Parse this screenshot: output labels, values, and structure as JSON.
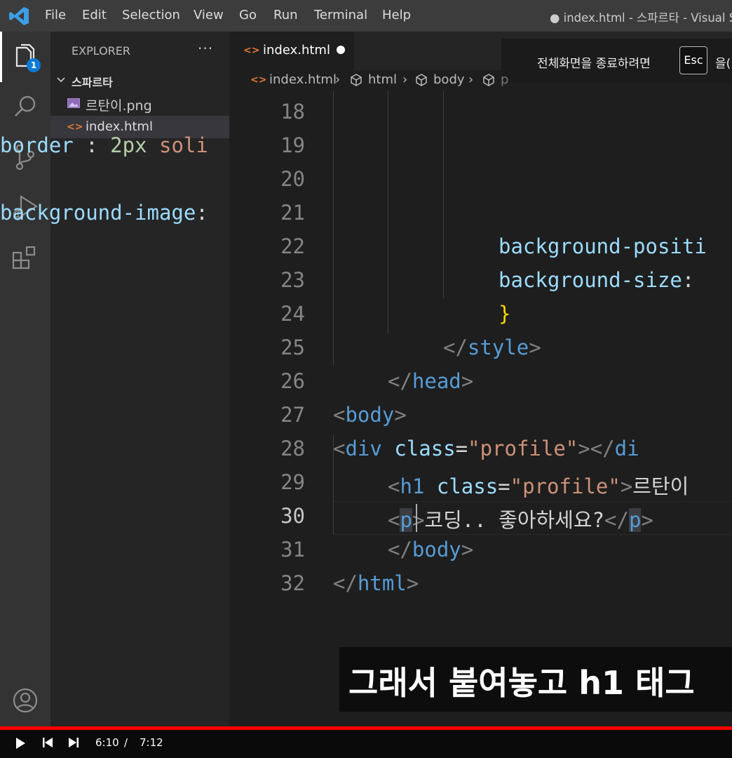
{
  "window": {
    "title": "● index.html - 스파르타 - Visual S"
  },
  "menu": [
    "File",
    "Edit",
    "Selection",
    "View",
    "Go",
    "Run",
    "Terminal",
    "Help"
  ],
  "activity_bar": {
    "items": [
      "explorer-icon",
      "search-icon",
      "source-control-icon",
      "run-debug-icon",
      "extensions-icon",
      "account-icon"
    ],
    "explorer_badge": "1"
  },
  "sidebar": {
    "title": "EXPLORER",
    "more": "···",
    "folder": "스파르타",
    "files": [
      {
        "name": "르탄이.png",
        "icon": "image-file-icon"
      },
      {
        "name": "index.html",
        "icon": "html-file-icon"
      }
    ]
  },
  "tabs": [
    {
      "label": "index.html",
      "icon": "<>",
      "modified": true
    }
  ],
  "fullscreen_notice": {
    "text": "전체화면을 종료하려면",
    "key": "Esc",
    "suffix": "을("
  },
  "breadcrumb": [
    "index.html",
    "html",
    "body",
    "p"
  ],
  "editor": {
    "active_line": 30,
    "lines": [
      {
        "n": "18",
        "tokens": []
      },
      {
        "n": "19",
        "tokens": [
          {
            "t": "border",
            "c": "c-prop"
          },
          {
            "t": " : ",
            "c": "c-punc"
          },
          {
            "t": "2px",
            "c": "c-num"
          },
          {
            "t": " soli",
            "c": "c-str"
          }
        ]
      },
      {
        "n": "20",
        "tokens": []
      },
      {
        "n": "21",
        "tokens": [
          {
            "t": "background-image",
            "c": "c-prop"
          },
          {
            "t": ":",
            "c": "c-punc"
          }
        ]
      },
      {
        "n": "22",
        "tokens": [
          {
            "t": "background-positi",
            "c": "c-prop"
          }
        ]
      },
      {
        "n": "23",
        "tokens": [
          {
            "t": "background-size",
            "c": "c-prop"
          },
          {
            "t": ": ",
            "c": "c-punc"
          }
        ]
      },
      {
        "n": "24",
        "tokens": [
          {
            "t": "}",
            "c": "c-gold"
          }
        ]
      },
      {
        "n": "25",
        "tokens": [
          {
            "t": "</",
            "c": "c-brk"
          },
          {
            "t": "style",
            "c": "c-tag"
          },
          {
            "t": ">",
            "c": "c-brk"
          }
        ]
      },
      {
        "n": "26",
        "tokens": [
          {
            "t": "</",
            "c": "c-brk"
          },
          {
            "t": "head",
            "c": "c-tag"
          },
          {
            "t": ">",
            "c": "c-brk"
          }
        ]
      },
      {
        "n": "27",
        "tokens": [
          {
            "t": "<",
            "c": "c-brk"
          },
          {
            "t": "body",
            "c": "c-tag"
          },
          {
            "t": ">",
            "c": "c-brk"
          }
        ]
      },
      {
        "n": "28",
        "tokens": [
          {
            "t": "<",
            "c": "c-brk"
          },
          {
            "t": "div",
            "c": "c-tag"
          },
          {
            "t": " ",
            "c": "c-text"
          },
          {
            "t": "class",
            "c": "c-attr"
          },
          {
            "t": "=",
            "c": "c-text"
          },
          {
            "t": "\"profile\"",
            "c": "c-str"
          },
          {
            "t": "></",
            "c": "c-brk"
          },
          {
            "t": "di",
            "c": "c-tag"
          }
        ]
      },
      {
        "n": "29",
        "tokens": [
          {
            "t": "<",
            "c": "c-brk"
          },
          {
            "t": "h1",
            "c": "c-tag"
          },
          {
            "t": " ",
            "c": "c-text"
          },
          {
            "t": "class",
            "c": "c-attr"
          },
          {
            "t": "=",
            "c": "c-text"
          },
          {
            "t": "\"profile\"",
            "c": "c-str"
          },
          {
            "t": ">",
            "c": "c-brk"
          },
          {
            "t": "르탄이",
            "c": "c-text"
          }
        ]
      },
      {
        "n": "30",
        "tokens": [
          {
            "t": "<",
            "c": "c-brk"
          },
          {
            "t": "p",
            "c": "c-tag hl-tag"
          },
          {
            "t": ">",
            "c": "c-brk"
          },
          {
            "t": "코딩.. 좋아하세요?",
            "c": "c-text"
          },
          {
            "t": "</",
            "c": "c-brk"
          },
          {
            "t": "p",
            "c": "c-tag hl-tag"
          },
          {
            "t": ">",
            "c": "c-brk"
          }
        ]
      },
      {
        "n": "31",
        "tokens": [
          {
            "t": "</",
            "c": "c-brk"
          },
          {
            "t": "body",
            "c": "c-tag"
          },
          {
            "t": ">",
            "c": "c-brk"
          }
        ]
      },
      {
        "n": "32",
        "tokens": [
          {
            "t": "</",
            "c": "c-brk"
          },
          {
            "t": "html",
            "c": "c-tag"
          },
          {
            "t": ">",
            "c": "c-brk"
          }
        ]
      }
    ]
  },
  "subtitle": "그래서 붙여놓고 h1 태그",
  "player": {
    "current_time": "6:10",
    "separator": "/",
    "total_time": "7:12",
    "progress_fraction": 0.857
  }
}
